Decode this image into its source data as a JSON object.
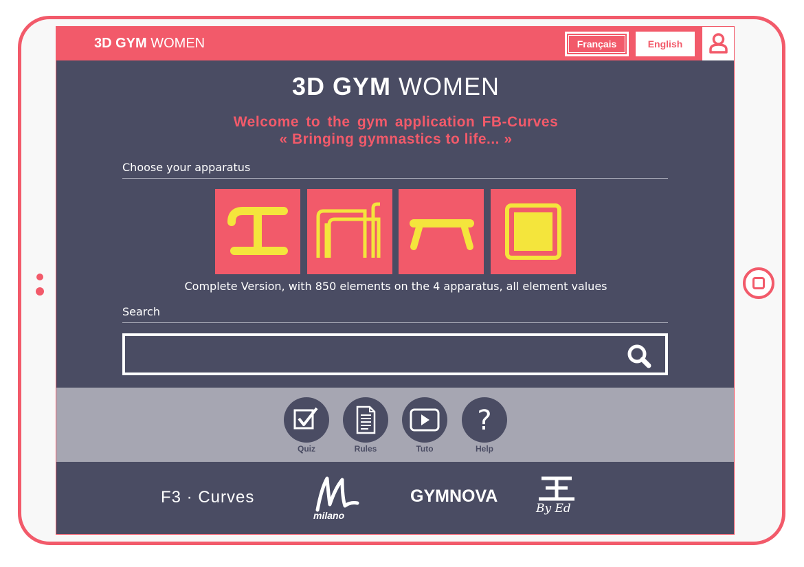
{
  "header": {
    "logo_bold": "3D GYM",
    "logo_light": "WOMEN",
    "lang_fr": "Français",
    "lang_en": "English"
  },
  "main": {
    "logo_bold": "3D GYM",
    "logo_light": "WOMEN",
    "welcome_line1": "Welcome to the gym application FB-Curves",
    "welcome_line2": "« Bringing gymnastics to life... »",
    "choose_label": "Choose your apparatus",
    "apparatus_note": "Complete Version, with 850 elements on the 4 apparatus, all element values",
    "search_label": "Search",
    "search_placeholder": ""
  },
  "toolbar": {
    "quiz": "Quiz",
    "rules": "Rules",
    "tuto": "Tuto",
    "help": "Help"
  },
  "footer": {
    "brand_fb": "F3 · Curves",
    "brand_milano": "milano",
    "brand_gymnova": "GYMNOVA",
    "brand_ed": "By Ed"
  },
  "colors": {
    "accent": "#f25a6a",
    "screen_bg": "#4a4c63",
    "toolbar_bg": "#a6a6b2",
    "apparatus_icon": "#f4e53c"
  },
  "icons": {
    "user": "user-icon",
    "search": "search-icon",
    "quiz": "checkbox-icon",
    "rules": "document-icon",
    "tuto": "play-icon",
    "help": "question-icon"
  }
}
